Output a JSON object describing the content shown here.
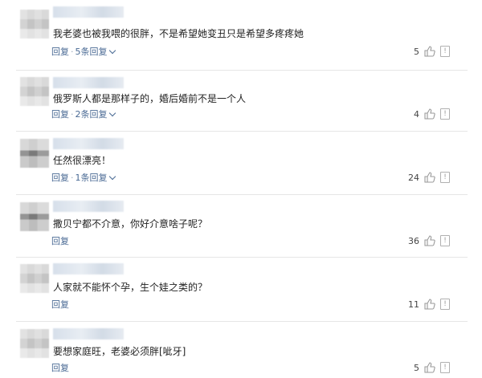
{
  "comments": [
    {
      "text": "我老婆也被我喂的很胖，不是希望她变丑只是希望多疼疼她",
      "reply_label": "回复",
      "separator": "·",
      "replies_label": "5条回复",
      "likes": "5"
    },
    {
      "text": "俄罗斯人都是那样子的，婚后婚前不是一个人",
      "reply_label": "回复",
      "separator": "·",
      "replies_label": "2条回复",
      "likes": "4"
    },
    {
      "text": "任然很漂亮！",
      "reply_label": "回复",
      "separator": "·",
      "replies_label": "1条回复",
      "likes": "24"
    },
    {
      "text": "撒贝宁都不介意，你好介意啥子呢？",
      "reply_label": "回复",
      "likes": "36"
    },
    {
      "text": "人家就不能怀个孕，生个娃之类的？",
      "reply_label": "回复",
      "likes": "11"
    },
    {
      "text": "要想家庭旺，老婆必须胖[呲牙]",
      "reply_label": "回复",
      "likes": "5"
    }
  ],
  "icons": {
    "like": "thumbs-up-icon",
    "report": "report-icon"
  },
  "colors": {
    "link": "#4a6a94",
    "divider": "#e6e6e6"
  }
}
